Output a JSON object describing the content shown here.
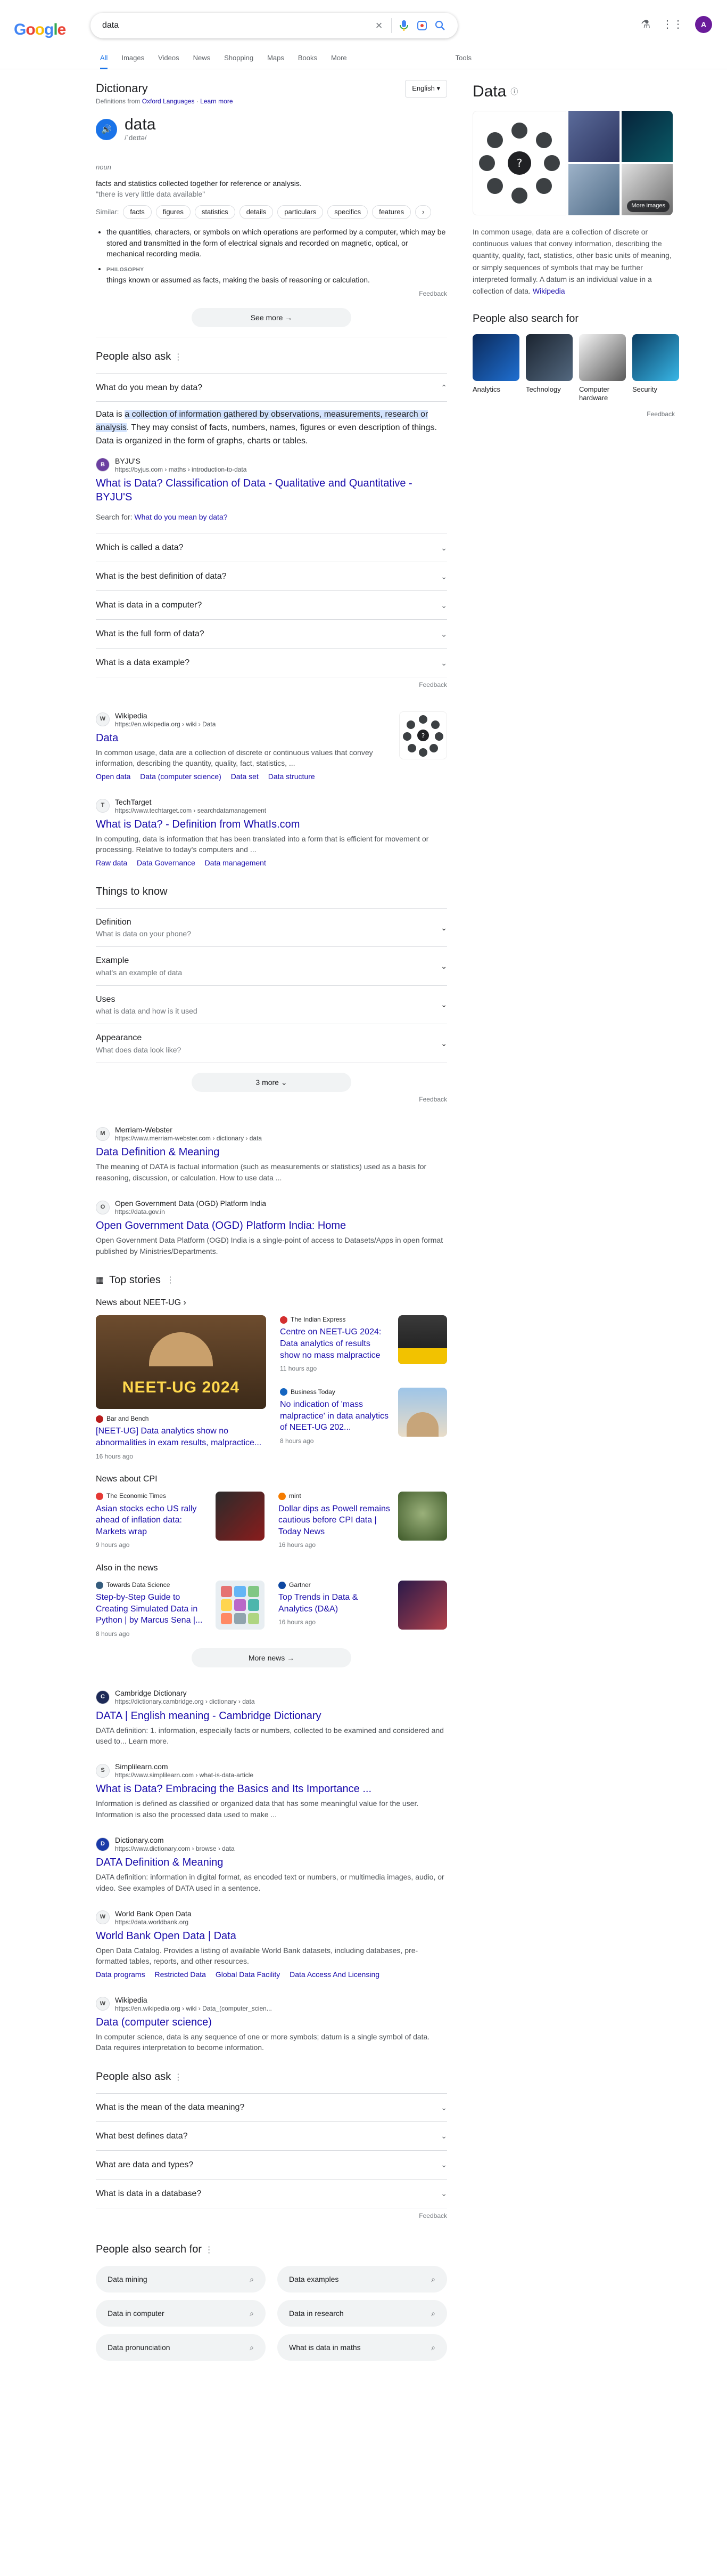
{
  "search": {
    "query": "data"
  },
  "tabs": [
    "All",
    "Images",
    "Videos",
    "News",
    "Shopping",
    "Maps",
    "Books",
    "More"
  ],
  "tools_label": "Tools",
  "avatar_letter": "A",
  "dictionary": {
    "title": "Dictionary",
    "definitions_from": "Definitions from",
    "source": "Oxford Languages",
    "learn_more": "Learn more",
    "language": "English",
    "word": "data",
    "phonetic": "/ˈdeɪtə/",
    "pos": "noun",
    "def1": "facts and statistics collected together for reference or analysis.",
    "example1": "\"there is very little data available\"",
    "similar_label": "Similar:",
    "similar": [
      "facts",
      "figures",
      "statistics",
      "details",
      "particulars",
      "specifics",
      "features"
    ],
    "def2": "the quantities, characters, or symbols on which operations are performed by a computer, which may be stored and transmitted in the form of electrical signals and recorded on magnetic, optical, or mechanical recording media.",
    "phil_label": "PHILOSOPHY",
    "def3": "things known or assumed as facts, making the basis of reasoning or calculation.",
    "see_more": "See more",
    "feedback": "Feedback"
  },
  "paa": {
    "title": "People also ask",
    "open_q": "What do you mean by data?",
    "answer_pre": "Data is ",
    "answer_hl": "a collection of information gathered by observations, measurements, research or analysis",
    "answer_post": ". They may consist of facts, numbers, names, figures or even description of things. Data is organized in the form of graphs, charts or tables.",
    "source_name": "BYJU'S",
    "source_url": "https://byjus.com › maths › introduction-to-data",
    "result_title": "What is Data? Classification of Data - Qualitative and Quantitative - BYJU'S",
    "search_for_label": "Search for:",
    "search_for_q": "What do you mean by data?",
    "questions": [
      "Which is called a data?",
      "What is the best definition of data?",
      "What is data in a computer?",
      "What is the full form of data?",
      "What is a data example?"
    ],
    "feedback": "Feedback"
  },
  "results1": [
    {
      "site": "Wikipedia",
      "url": "https://en.wikipedia.org › wiki › Data",
      "fav": "W",
      "title": "Data",
      "snippet": "In common usage, data are a collection of discrete or continuous values that convey information, describing the quantity, quality, fact, statistics, ...",
      "links": [
        "Open data",
        "Data (computer science)",
        "Data set",
        "Data structure"
      ]
    },
    {
      "site": "TechTarget",
      "url": "https://www.techtarget.com › searchdatamanagement",
      "fav": "T",
      "title": "What is Data? - Definition from WhatIs.com",
      "snippet": "In computing, data is information that has been translated into a form that is efficient for movement or processing. Relative to today's computers and ...",
      "links": [
        "Raw data",
        "Data Governance",
        "Data management"
      ]
    }
  ],
  "ttk": {
    "title": "Things to know",
    "items": [
      {
        "t": "Definition",
        "s": "What is data on your phone?"
      },
      {
        "t": "Example",
        "s": "what's an example of data"
      },
      {
        "t": "Uses",
        "s": "what is data and how is it used"
      },
      {
        "t": "Appearance",
        "s": "What does data look like?"
      }
    ],
    "more": "3 more",
    "feedback": "Feedback"
  },
  "results2": [
    {
      "site": "Merriam-Webster",
      "url": "https://www.merriam-webster.com › dictionary › data",
      "fav": "M",
      "title": "Data Definition & Meaning",
      "snippet": "The meaning of DATA is factual information (such as measurements or statistics) used as a basis for reasoning, discussion, or calculation. How to use data ..."
    },
    {
      "site": "Open Government Data (OGD) Platform India",
      "url": "https://data.gov.in",
      "fav": "O",
      "title": "Open Government Data (OGD) Platform India: Home",
      "snippet": "Open Government Data Platform (OGD) India is a single-point of access to Datasets/Apps in open format published by Ministries/Departments."
    }
  ],
  "stories": {
    "title": "Top stories",
    "cat1": "News about NEET-UG",
    "neet_img_text": "NEET-UG 2024",
    "s1": {
      "pub": "Bar and Bench",
      "title": "[NEET-UG] Data analytics show no abnormalities in exam results, malpractice...",
      "age": "16 hours ago"
    },
    "s2": {
      "pub": "The Indian Express",
      "title": "Centre on NEET-UG 2024: Data analytics of results show no mass malpractice",
      "age": "11 hours ago"
    },
    "s3": {
      "pub": "Business Today",
      "title": "No indication of 'mass malpractice' in data analytics of NEET-UG 202...",
      "age": "8 hours ago"
    },
    "cat2": "News about CPI",
    "s4": {
      "pub": "The Economic Times",
      "title": "Asian stocks echo US rally ahead of inflation data: Markets wrap",
      "age": "9 hours ago"
    },
    "s5": {
      "pub": "mint",
      "title": "Dollar dips as Powell remains cautious before CPI data | Today News",
      "age": "16 hours ago"
    },
    "cat3": "Also in the news",
    "s6": {
      "pub": "Towards Data Science",
      "title": "Step-by-Step Guide to Creating Simulated Data in Python | by Marcus Sena |...",
      "age": "8 hours ago"
    },
    "s7": {
      "pub": "Gartner",
      "title": "Top Trends in Data & Analytics (D&A)",
      "age": "16 hours ago"
    },
    "more": "More news"
  },
  "results3": [
    {
      "site": "Cambridge Dictionary",
      "url": "https://dictionary.cambridge.org › dictionary › data",
      "fav": "C",
      "title": "DATA | English meaning - Cambridge Dictionary",
      "snippet": "DATA definition: 1. information, especially facts or numbers, collected to be examined and considered and used to... Learn more."
    },
    {
      "site": "Simplilearn.com",
      "url": "https://www.simplilearn.com › what-is-data-article",
      "fav": "S",
      "title": "What is Data? Embracing the Basics and Its Importance ...",
      "snippet": "Information is defined as classified or organized data that has some meaningful value for the user. Information is also the processed data used to make ..."
    },
    {
      "site": "Dictionary.com",
      "url": "https://www.dictionary.com › browse › data",
      "fav": "D",
      "title": "DATA Definition & Meaning",
      "snippet": "DATA definition: information in digital format, as encoded text or numbers, or multimedia images, audio, or video. See examples of DATA used in a sentence."
    },
    {
      "site": "World Bank Open Data",
      "url": "https://data.worldbank.org",
      "fav": "W",
      "title": "World Bank Open Data | Data",
      "snippet": "Open Data Catalog. Provides a listing of available World Bank datasets, including databases, pre-formatted tables, reports, and other resources.",
      "links": [
        "Data programs",
        "Restricted Data",
        "Global Data Facility",
        "Data Access And Licensing"
      ]
    },
    {
      "site": "Wikipedia",
      "url": "https://en.wikipedia.org › wiki › Data_(computer_scien...",
      "fav": "W",
      "title": "Data (computer science)",
      "snippet": "In computer science, data is any sequence of one or more symbols; datum is a single symbol of data. Data requires interpretation to become information."
    }
  ],
  "paa2": {
    "title": "People also ask",
    "questions": [
      "What is the mean of the data meaning?",
      "What best defines data?",
      "What are data and types?",
      "What is data in a database?"
    ],
    "feedback": "Feedback"
  },
  "related": {
    "title": "People also search for",
    "items": [
      "Data mining",
      "Data examples",
      "Data in computer",
      "Data in research",
      "Data pronunciation",
      "What is data in maths"
    ]
  },
  "kp": {
    "title": "Data",
    "more_images": "More images",
    "desc": "In common usage, data are a collection of discrete or continuous values that convey information, describing the quantity, quality, fact, statistics, other basic units of meaning, or simply sequences of symbols that may be further interpreted formally. A datum is an individual value in a collection of data.",
    "wiki": "Wikipedia",
    "rel_title": "People also search for",
    "rel": [
      "Analytics",
      "Technology",
      "Computer hardware",
      "Security"
    ],
    "feedback": "Feedback"
  }
}
